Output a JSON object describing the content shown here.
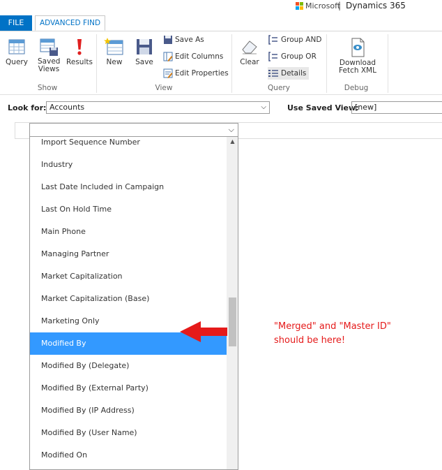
{
  "brand": {
    "microsoft": "Microsoft",
    "separator": "|",
    "product": "Dynamics 365"
  },
  "tabs": [
    {
      "label": "FILE"
    },
    {
      "label": "ADVANCED FIND"
    }
  ],
  "ribbon": {
    "show": {
      "label": "Show",
      "query": "Query",
      "saved_views": "Saved Views",
      "results": "Results"
    },
    "view": {
      "label": "View",
      "new": "New",
      "save": "Save",
      "save_as": "Save As",
      "edit_columns": "Edit Columns",
      "edit_properties": "Edit Properties"
    },
    "query": {
      "label": "Query",
      "clear": "Clear",
      "group_and": "Group AND",
      "group_or": "Group OR",
      "details": "Details"
    },
    "debug": {
      "label": "Debug",
      "download_fetch_xml": "Download Fetch XML"
    }
  },
  "lookfor": {
    "label": "Look for:",
    "value": "Accounts"
  },
  "saved_view": {
    "label": "Use Saved View:",
    "value": "[new]"
  },
  "dropdown": {
    "items": [
      "Import Sequence Number",
      "Industry",
      "Last Date Included in Campaign",
      "Last On Hold Time",
      "Main Phone",
      "Managing Partner",
      "Market Capitalization",
      "Market Capitalization (Base)",
      "Marketing Only",
      "Modified By",
      "Modified By (Delegate)",
      "Modified By (External Party)",
      "Modified By (IP Address)",
      "Modified By (User Name)",
      "Modified On"
    ],
    "selected": "Modified By"
  },
  "annotation": {
    "line1": "\"Merged\" and \"Master ID\"",
    "line2": "should be here!"
  },
  "colors": {
    "accent": "#0072c6",
    "selection": "#3399ff",
    "annotation": "#e51a1a"
  },
  "icons": {
    "query": "table-grid-icon",
    "saved_views": "saved-views-icon",
    "results": "exclamation-icon",
    "new": "new-grid-icon",
    "save": "floppy-disk-icon",
    "save_as": "floppy-small-icon",
    "edit_columns": "edit-columns-icon",
    "edit_properties": "edit-properties-icon",
    "clear": "eraser-icon",
    "group_and": "group-and-icon",
    "group_or": "group-or-icon",
    "details": "details-icon",
    "download_fetch_xml": "xml-file-icon"
  }
}
